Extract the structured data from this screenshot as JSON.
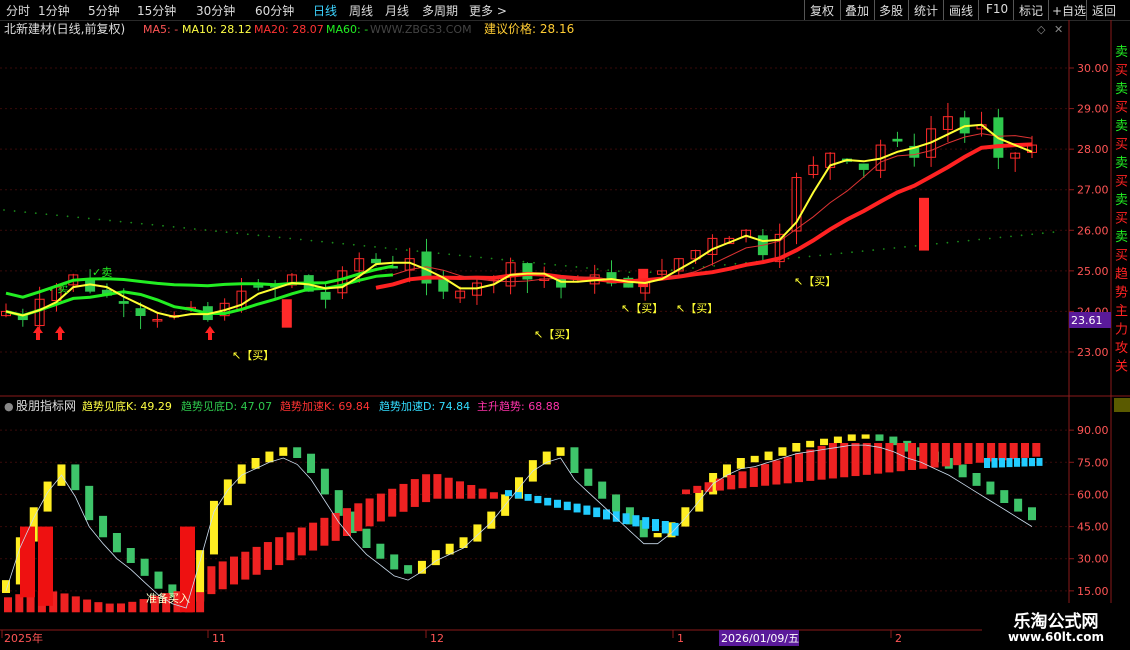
{
  "toolbar": {
    "periods": [
      "分时",
      "1分钟",
      "5分钟",
      "15分钟",
      "30分钟",
      "60分钟",
      "日线",
      "周线",
      "月线",
      "多周期",
      "更多 >"
    ],
    "active_period": "日线",
    "right_buttons": [
      "复权",
      "叠加",
      "多股",
      "统计",
      "画线",
      "F10",
      "标记",
      "+自选",
      "返回"
    ]
  },
  "main_chart": {
    "header": {
      "title": "北新建材(日线,前复权)",
      "ma5": "MA5: -",
      "ma10": "MA10: 28.12",
      "ma20": "MA20: 28.07",
      "ma60": "MA60: -",
      "site": "WWW.ZBGS3.COM",
      "advice": "建议价格: 28.16"
    },
    "current_price": "23.61",
    "signals": {
      "buy": "↖【买】",
      "sell": "✓卖"
    },
    "colors": {
      "up": "#ff2a2a",
      "down": "#2ec84d",
      "ma_yellow": "#ffff33",
      "ma_red": "#ff2222",
      "ma_green": "#22ee22"
    }
  },
  "chart_data": [
    {
      "type": "candlestick",
      "title": "北新建材(日线,前复权)",
      "y_ticks": [
        "30.00",
        "29.00",
        "28.00",
        "27.00",
        "26.00",
        "25.00",
        "24.00",
        "23.00"
      ],
      "ylim": [
        22.3,
        30.9
      ],
      "ma_values": {
        "MA10": 28.12,
        "MA20": 28.07
      },
      "advice_price": 28.16,
      "close_path": [
        24.0,
        23.8,
        24.3,
        24.6,
        24.9,
        24.5,
        24.4,
        24.2,
        23.9,
        23.8,
        23.9,
        24.1,
        23.8,
        24.2,
        24.5,
        24.6,
        24.6,
        24.9,
        24.5,
        24.3,
        25.0,
        25.3,
        25.2,
        25.1,
        25.3,
        24.7,
        24.5,
        24.5,
        24.7,
        24.8,
        25.2,
        24.8,
        24.8,
        24.6,
        24.8,
        24.9,
        24.7,
        24.6,
        24.8,
        25.0,
        25.3,
        25.5,
        25.8,
        25.8,
        26.0,
        25.4,
        25.9,
        27.3,
        27.6,
        27.9,
        27.7,
        27.5,
        28.1,
        28.2,
        27.8,
        28.5,
        28.8,
        28.4,
        28.6,
        27.8,
        27.9,
        28.1
      ]
    },
    {
      "type": "bar",
      "title": "股朋指标网",
      "series": [
        {
          "name": "趋势见底K",
          "value": 49.29
        },
        {
          "name": "趋势见底D",
          "value": 47.07
        },
        {
          "name": "趋势加速K",
          "value": 69.84
        },
        {
          "name": "趋势加速D",
          "value": 74.84
        },
        {
          "name": "主升趋势",
          "value": 68.88
        }
      ],
      "y_ticks": [
        "90.00",
        "75.00",
        "60.00",
        "45.00",
        "30.00",
        "15.00"
      ],
      "ylim": [
        0,
        98
      ],
      "annotation": "准备买入",
      "k_path": [
        18,
        38,
        52,
        64,
        72,
        62,
        48,
        40,
        33,
        28,
        22,
        16,
        12,
        10,
        32,
        55,
        65,
        72,
        75,
        78,
        80,
        77,
        70,
        60,
        50,
        42,
        35,
        30,
        25,
        23,
        27,
        32,
        35,
        38,
        44,
        50,
        58,
        66,
        74,
        78,
        80,
        70,
        64,
        58,
        52,
        46,
        40,
        40,
        45,
        52,
        60,
        68,
        72,
        75,
        76,
        78,
        80,
        82,
        83,
        84,
        85,
        86,
        86,
        85,
        83,
        80,
        78,
        75,
        72,
        68,
        64,
        60,
        56,
        52,
        48
      ]
    },
    {
      "type": "axis",
      "x_labels": [
        "2025年",
        "11",
        "12",
        "1",
        "2026/01/09/五",
        "2"
      ]
    }
  ],
  "indicator": {
    "header": {
      "name": "股朋指标网",
      "k1": "趋势见底K: 49.29",
      "d1": "趋势见底D: 47.07",
      "k2": "趋势加速K: 69.84",
      "d2": "趋势加速D: 74.84",
      "main": "主升趋势: 68.88"
    },
    "annotation": "准备买入"
  },
  "date_axis": {
    "labels": [
      "2025年",
      "11",
      "12",
      "1",
      "2",
      "2026/01/09/五"
    ]
  },
  "right_panel_chars": "卖买卖买卖买卖买卖买卖买趋势主力攻关",
  "watermark": {
    "title": "乐淘公式网",
    "url": "www.60lt.com"
  }
}
